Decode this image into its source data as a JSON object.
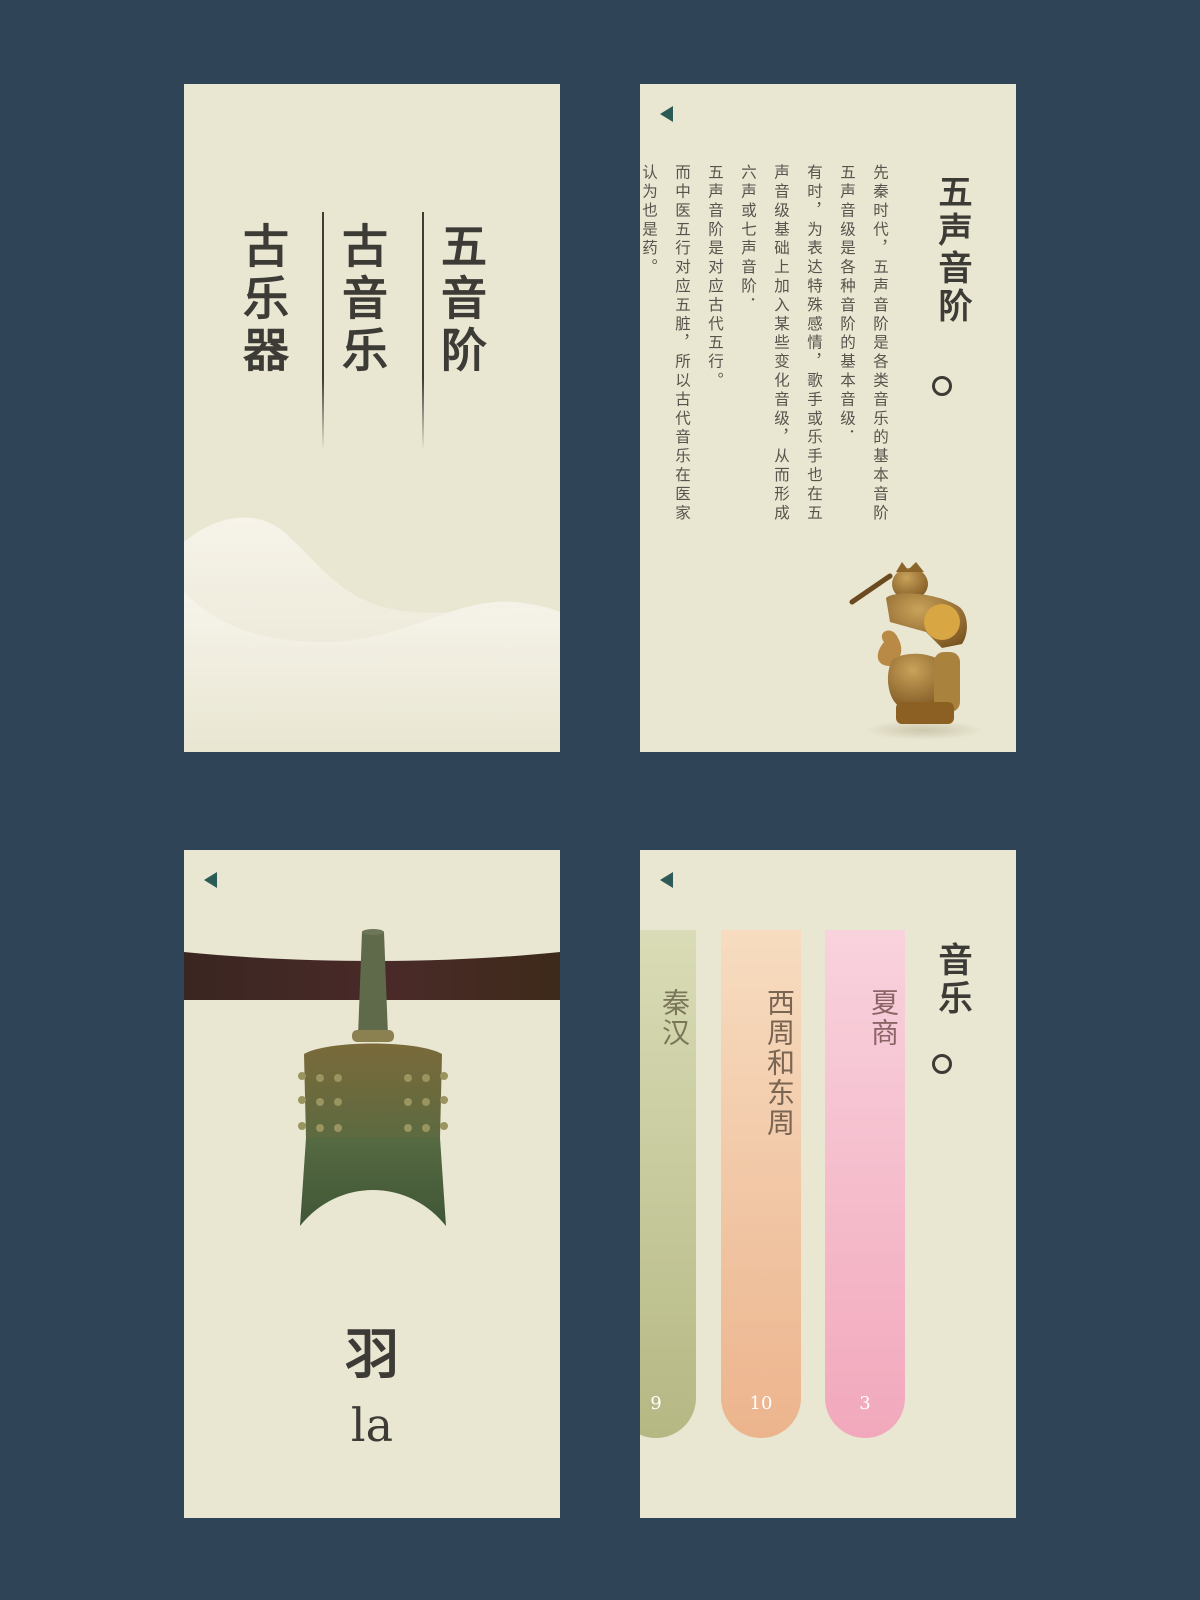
{
  "card1": {
    "menu": [
      "五音阶",
      "古音乐",
      "古乐器"
    ]
  },
  "card2": {
    "title": "五声音阶",
    "paragraphs": [
      "先秦时代，五声音阶是各类音乐的基本音阶",
      "五声音级是各种音阶的基本音级．",
      "有时，为表达特殊感情，歌手或乐手也在五",
      "声音级基础上加入某些变化音级，从而形成",
      "六声或七声音阶．",
      "五声音阶是对应古代五行。",
      "而中医五行对应五脏，所以古代音乐在医家",
      "认为也是药。"
    ]
  },
  "card3": {
    "note_char": "羽",
    "note_pinyin": "la"
  },
  "card4": {
    "title": "音乐",
    "eras": [
      {
        "name": "夏商",
        "count": "3",
        "color_top": "#f8d2dd",
        "color_bottom": "#f2a8bc"
      },
      {
        "name": "西周和东周",
        "count": "10",
        "color_top": "#f7dcc0",
        "color_bottom": "#ecb48d"
      },
      {
        "name": "秦汉",
        "count": "9",
        "color_top": "#d9dcb6",
        "color_bottom": "#b5b883"
      }
    ]
  },
  "icons": {
    "back": "back-triangle-icon",
    "circle": "circle-icon"
  },
  "colors": {
    "background": "#2f4557",
    "card": "#e9e6d2",
    "text": "#3d3b36",
    "accent": "#2c5a55"
  }
}
